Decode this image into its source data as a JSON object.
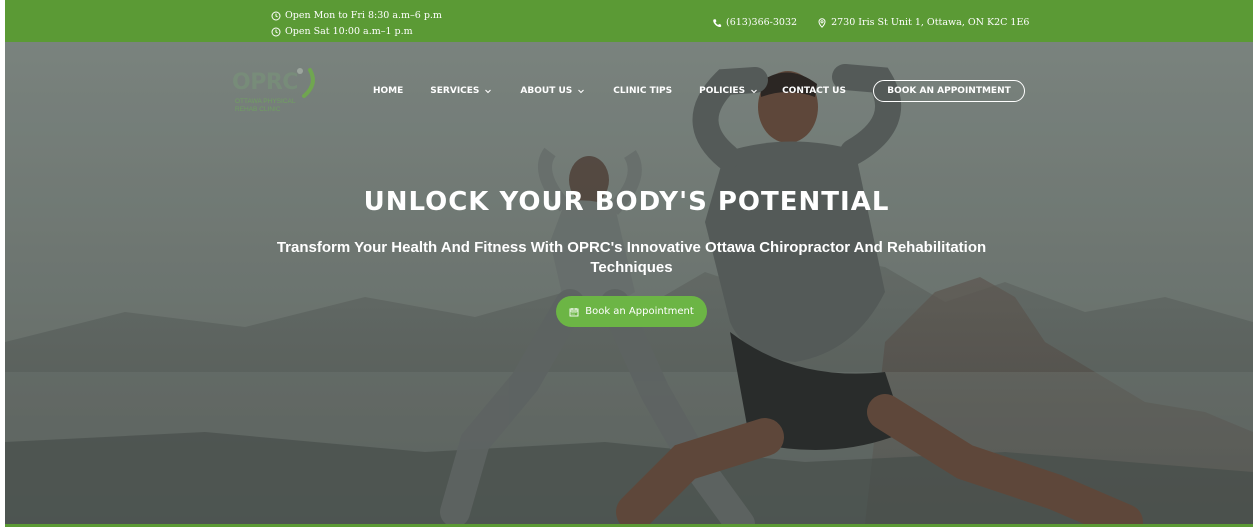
{
  "topbar": {
    "hours": [
      {
        "icon": "clock-icon",
        "text": "Open Mon to Fri 8:30 a.m–6 p.m"
      },
      {
        "icon": "clock-icon",
        "text": "Open Sat 10:00 a.m–1 p.m"
      }
    ],
    "phone": {
      "icon": "phone-icon",
      "text": "(613)366-3032"
    },
    "address": {
      "icon": "location-pin-icon",
      "text": "2730 Iris St Unit 1, Ottawa, ON K2C 1E6"
    },
    "background": "#5b9a35"
  },
  "logo": {
    "word": "OPRC",
    "tagline_line1": "Ottawa Physical",
    "tagline_line2": "Rehab Clinic"
  },
  "nav": {
    "items": [
      {
        "label": "HOME",
        "dropdown": false
      },
      {
        "label": "SERVICES",
        "dropdown": true
      },
      {
        "label": "ABOUT US",
        "dropdown": true
      },
      {
        "label": "CLINIC TIPS",
        "dropdown": false
      },
      {
        "label": "POLICIES",
        "dropdown": true
      },
      {
        "label": "CONTACT US",
        "dropdown": false
      }
    ],
    "book_button": "BOOK AN APPOINTMENT"
  },
  "hero": {
    "headline": "UNLOCK YOUR BODY'S POTENTIAL",
    "subheadline": "Transform Your Health And Fitness With OPRC's Innovative Ottawa Chiropractor And Rehabilitation Techniques",
    "cta": {
      "icon": "calendar-icon",
      "label": "Book an Appointment"
    },
    "cta_color": "#6cb545"
  }
}
